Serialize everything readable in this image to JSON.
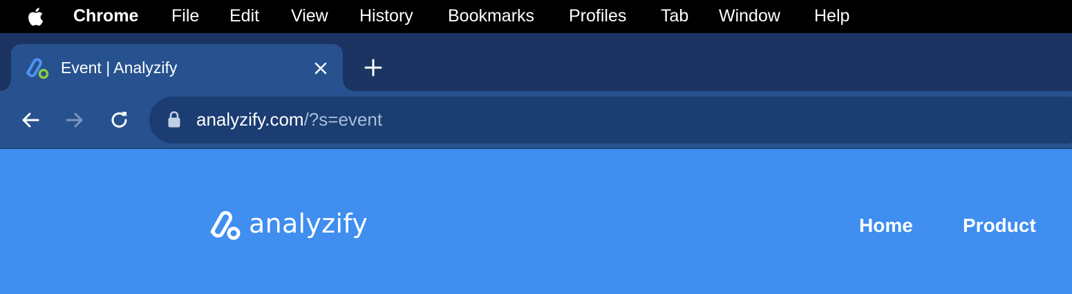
{
  "menubar": {
    "apple_icon": "apple-logo-icon",
    "items": [
      "Chrome",
      "File",
      "Edit",
      "View",
      "History",
      "Bookmarks",
      "Profiles",
      "Tab",
      "Window",
      "Help"
    ]
  },
  "tabs": [
    {
      "title": "Event | Analyzify",
      "favicon": "analyzify-favicon-icon",
      "active": true
    }
  ],
  "toolbar": {
    "back_icon": "arrow-left-icon",
    "forward_icon": "arrow-right-icon",
    "reload_icon": "reload-icon",
    "url_host": "analyzify.com",
    "url_path": "/?s=event"
  },
  "page": {
    "brand": "analyzify",
    "nav": [
      "Home",
      "Product"
    ]
  },
  "colors": {
    "menubar_bg": "#000000",
    "tabstrip_bg": "#1b3461",
    "tab_active_bg": "#27528f",
    "omnibox_bg": "#1b3d72",
    "page_bg": "#3f8ef0",
    "favicon_accent": "#8ccc3f"
  }
}
